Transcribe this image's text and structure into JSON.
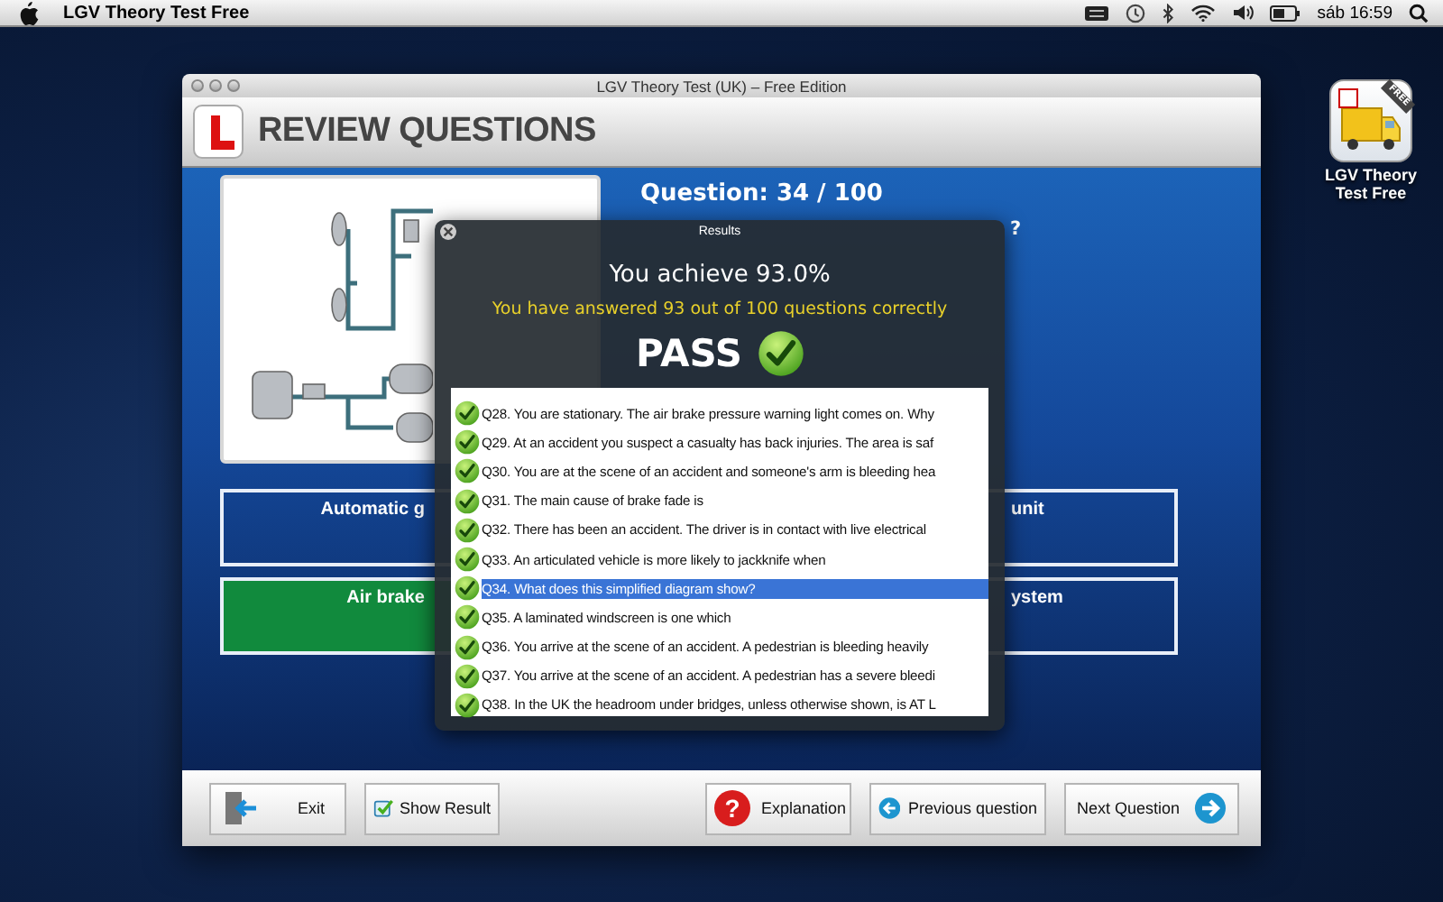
{
  "menu_bar": {
    "app_name": "LGV Theory Test Free",
    "clock": "sáb 16:59"
  },
  "desktop_icon": {
    "ribbon": "FREE",
    "label": "LGV Theory Test Free"
  },
  "window": {
    "title": "LGV Theory Test (UK) – Free Edition"
  },
  "header": {
    "title": "REVIEW QUESTIONS"
  },
  "question": {
    "number": "Question: 34 / 100",
    "text": "?"
  },
  "answers": [
    {
      "text": "Automatic g",
      "correct": false
    },
    {
      "text": "unit",
      "correct": false
    },
    {
      "text": "Air brake",
      "correct": true
    },
    {
      "text": "ystem",
      "correct": false
    }
  ],
  "results": {
    "title": "Results",
    "score": "You achieve 93.0%",
    "summary": "You have answered 93 out of 100 questions correctly",
    "verdict": "PASS",
    "rows": [
      {
        "text": "Q28. You are stationary. The air brake pressure warning light comes on. Why",
        "correct": true,
        "selected": false
      },
      {
        "text": "Q29. At an accident  you suspect a casualty has back injuries. The area is saf",
        "correct": true,
        "selected": false
      },
      {
        "text": "Q30. You are at the scene of an accident  and someone's arm is bleeding hea",
        "correct": true,
        "selected": false
      },
      {
        "text": "Q31. The main cause of  brake fade  is",
        "correct": true,
        "selected": false
      },
      {
        "text": "Q32. There has been an accident. The driver is in contact with live electrical",
        "correct": true,
        "selected": false
      },
      {
        "text": "Q33. An articulated vehicle is more likely to jackknife when",
        "correct": true,
        "selected": false
      },
      {
        "text": "Q34. What does this simplified diagram show?",
        "correct": true,
        "selected": true
      },
      {
        "text": "Q35. A laminated windscreen is one which",
        "correct": true,
        "selected": false
      },
      {
        "text": "Q36. You arrive at the scene of an accident. A pedestrian is bleeding heavily",
        "correct": true,
        "selected": false
      },
      {
        "text": "Q37. You arrive at the scene of an accident. A pedestrian has a severe bleedi",
        "correct": true,
        "selected": false
      },
      {
        "text": "Q38. In the UK the headroom under bridges, unless otherwise shown, is AT L",
        "correct": true,
        "selected": false
      }
    ]
  },
  "toolbar": [
    {
      "label": "Exit",
      "kind": "exit"
    },
    {
      "label": "Show Result",
      "kind": "result"
    },
    {
      "label": "Explanation",
      "kind": "explanation",
      "icon": "?"
    },
    {
      "label": "Previous question",
      "kind": "previous"
    },
    {
      "label": "Next Question",
      "kind": "next"
    }
  ]
}
